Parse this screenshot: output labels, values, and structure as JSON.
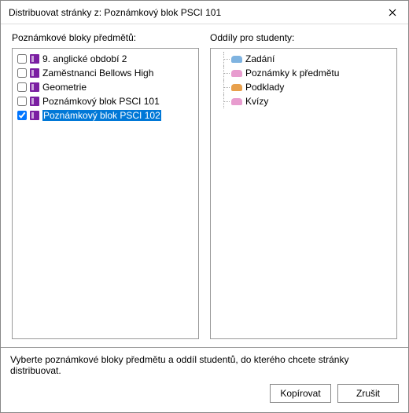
{
  "titlebar": {
    "title": "Distribuovat stránky z: Poznámkový blok PSCI 101"
  },
  "left": {
    "header": "Poznámkové bloky předmětů:",
    "items": [
      {
        "checked": false,
        "color": "#7b1fa2",
        "label": "9. anglické období 2",
        "selected": false
      },
      {
        "checked": false,
        "color": "#7b1fa2",
        "label": "Zaměstnanci Bellows High",
        "selected": false
      },
      {
        "checked": false,
        "color": "#7b1fa2",
        "label": "Geometrie",
        "selected": false
      },
      {
        "checked": false,
        "color": "#7b1fa2",
        "label": "Poznámkový blok PSCI 101",
        "selected": false
      },
      {
        "checked": true,
        "color": "#7b1fa2",
        "label": "Poznámkový blok PSCI 102",
        "selected": true
      }
    ]
  },
  "right": {
    "header": "Oddíly pro studenty:",
    "items": [
      {
        "color": "#7fb3e0",
        "label": "Zadání"
      },
      {
        "color": "#e89ccf",
        "label": "Poznámky k předmětu"
      },
      {
        "color": "#e8a04c",
        "label": "Podklady"
      },
      {
        "color": "#e89ccf",
        "label": "Kvízy"
      }
    ]
  },
  "footer": {
    "text": "Vyberte poznámkové bloky předmětu a oddíl studentů, do kterého chcete stránky distribuovat.",
    "copy": "Kopírovat",
    "cancel": "Zrušit"
  }
}
